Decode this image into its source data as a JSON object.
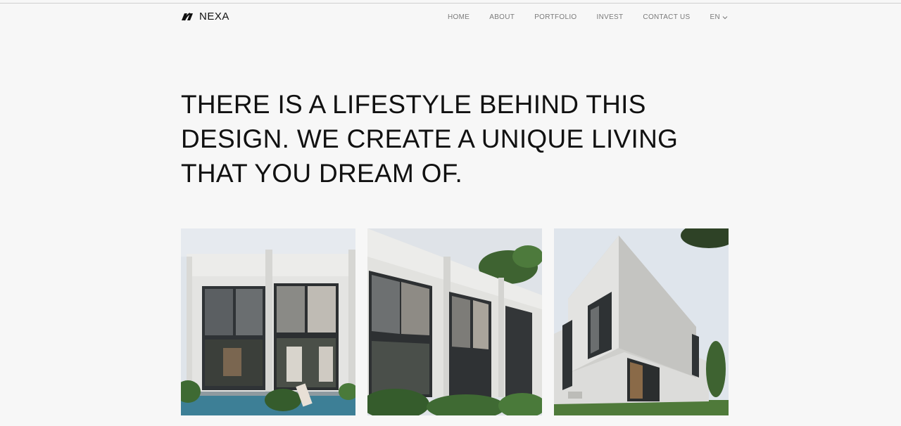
{
  "header": {
    "logo_text": "NEXA",
    "nav": [
      {
        "label": "HOME"
      },
      {
        "label": "ABOUT"
      },
      {
        "label": "PORTFOLIO"
      },
      {
        "label": "INVEST"
      },
      {
        "label": "CONTACT US"
      }
    ],
    "language": "EN"
  },
  "hero": {
    "line1": "THERE IS A LIFESTYLE BEHIND THIS",
    "line2": "DESIGN. WE CREATE A UNIQUE LIVING",
    "line3": "THAT YOU DREAM OF."
  },
  "colors": {
    "background": "#f7f7f7",
    "text": "#111111",
    "nav_text": "#7a7a7a"
  },
  "icons": [
    "nexa-logo-icon",
    "chevron-down-icon"
  ]
}
